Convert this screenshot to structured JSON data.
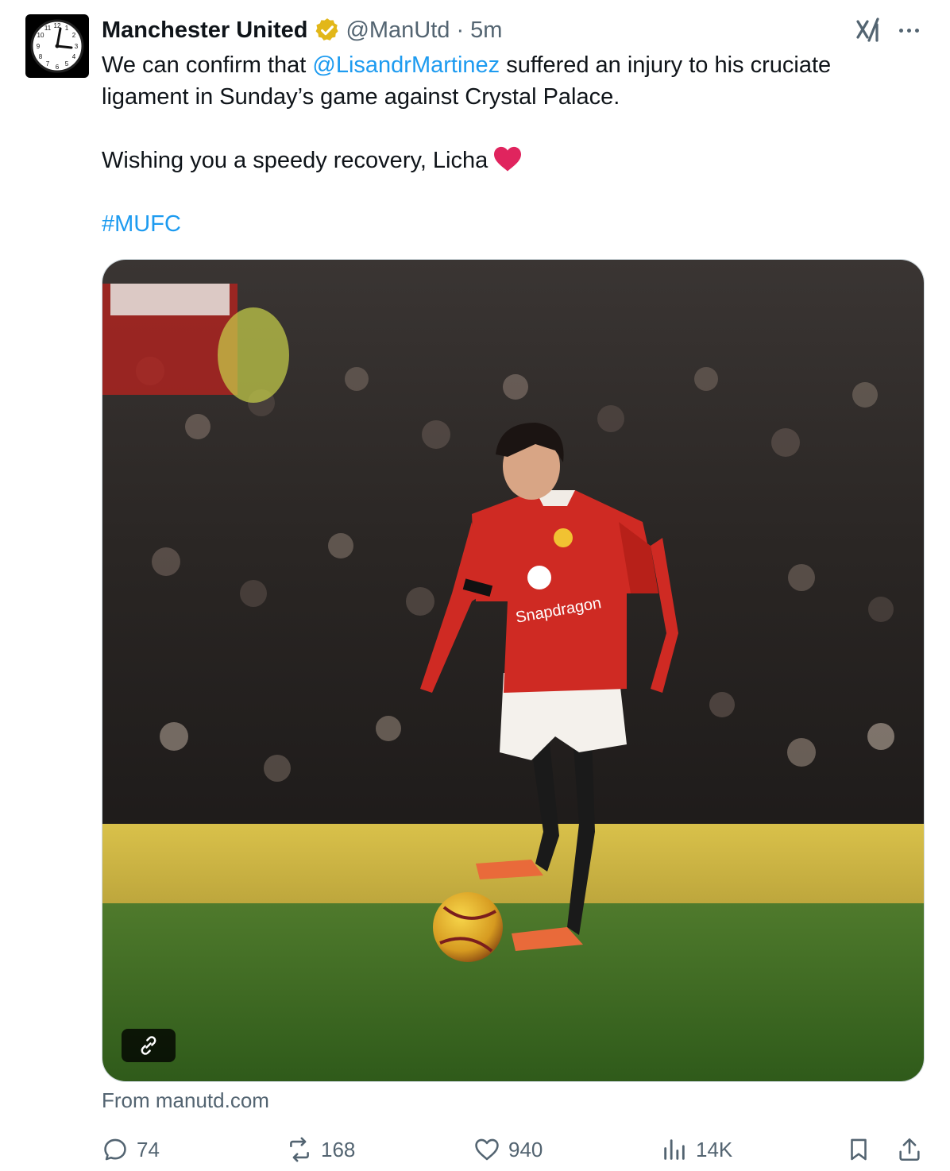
{
  "author": {
    "name": "Manchester United",
    "handle": "@ManUtd",
    "separator": "·",
    "time": "5m",
    "avatar_icon": "clock-icon",
    "verified_icon": "gold-verified-badge-icon",
    "verified_color": "#e2b719"
  },
  "tweet": {
    "line1_before": "We can confirm that ",
    "mention": "@LisandrMartinez",
    "line1_after": " suffered an injury to his cruciate ligament in Sunday’s game against Crystal Palace.",
    "line2": "Wishing you a speedy recovery, Licha",
    "emoji_icon": "red-heart-icon",
    "hashtag": "#MUFC"
  },
  "media": {
    "description_icon": "photo-player-on-pitch",
    "link_icon": "link-icon",
    "source": "From manutd.com"
  },
  "actions": {
    "replies": "74",
    "reposts": "168",
    "likes": "940",
    "views": "14K"
  },
  "colors": {
    "link": "#1d9bf0",
    "muted": "#536471",
    "text": "#0f1419",
    "heart": "#e0245e"
  }
}
